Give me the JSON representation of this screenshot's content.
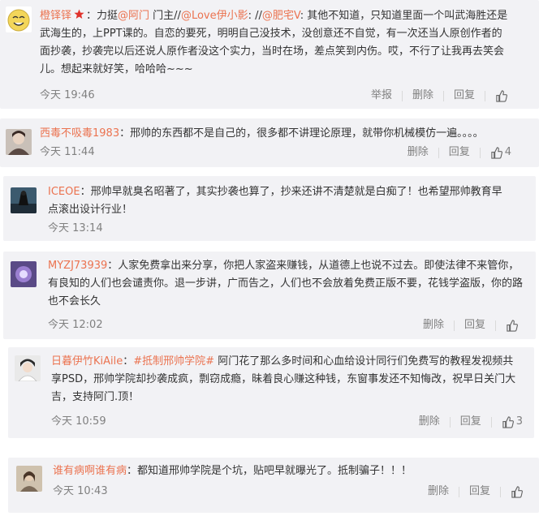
{
  "comments": [
    {
      "username": "橙铎铎",
      "text_parts": [
        "：力挺",
        "@阿门",
        " 门主//",
        "@Love伊小影",
        ": //",
        "@肥宅V",
        ": 其他不知道，只知道里面一个叫武海胜还是武海生的，上PPT课的。自恋的要死，明明自己没技术，没创意还不自觉，有一次还当人原创作者的面抄袭，抄袭完以后还说人原作者没这个实力，当时在场，差点笑到内伤。哎，不行了让我再去笑会儿。想起来就好笑，哈哈哈~~~"
      ],
      "time": "今天 19:46",
      "report": "举报",
      "delete": "删除",
      "reply": "回复",
      "likes": ""
    },
    {
      "username": "西毒不吸毒1983",
      "text": "：邢帅的东西都不是自己的，很多都不讲理论原理，就带你机械模仿一遍。。。。",
      "time": "今天 11:44",
      "delete": "删除",
      "reply": "回复",
      "likes": "4"
    },
    {
      "username": "ICEOE",
      "text": "：邢帅早就臭名昭著了，其实抄袭也算了，抄来还讲不清楚就是白痴了！也希望邢帅教育早点滚出设计行业！",
      "time": "今天 13:14",
      "delete": "",
      "reply": "",
      "likes": ""
    },
    {
      "username": "MYZJ73939",
      "text": "：人家免费拿出来分享，你把人家盗来赚钱，从道德上也说不过去。即使法律不来管你，有良知的人们也会谴责你。退一步讲，广而告之，人们也不会放着免费正版不要，花钱学盗版，你的路也不会长久",
      "time": "今天 12:02",
      "delete": "删除",
      "reply": "回复",
      "likes": ""
    },
    {
      "username": "日暮伊竹KiAile",
      "text_parts": [
        "：",
        "#抵制邢帅学院#",
        " 阿门花了那么多时间和心血给设计同行们免费写的教程发视频共享PSD，邢帅学院却抄袭成疯，剽窃成瘾，昧着良心赚这种钱，东窗事发还不知悔改，祝早日关门大吉，支持阿门.顶！"
      ],
      "time": "今天 10:59",
      "delete": "删除",
      "reply": "回复",
      "likes": "3"
    },
    {
      "username": "谁有病啊谁有病",
      "text": "：都知道邢帅学院是个坑，贴吧早就曝光了。抵制骗子！！！",
      "time": "今天 10:43",
      "delete": "删除",
      "reply": "回复",
      "likes": ""
    }
  ],
  "colors": {
    "username": "#eb7350",
    "card_bg": "#f2f2f5",
    "muted": "#808080"
  }
}
